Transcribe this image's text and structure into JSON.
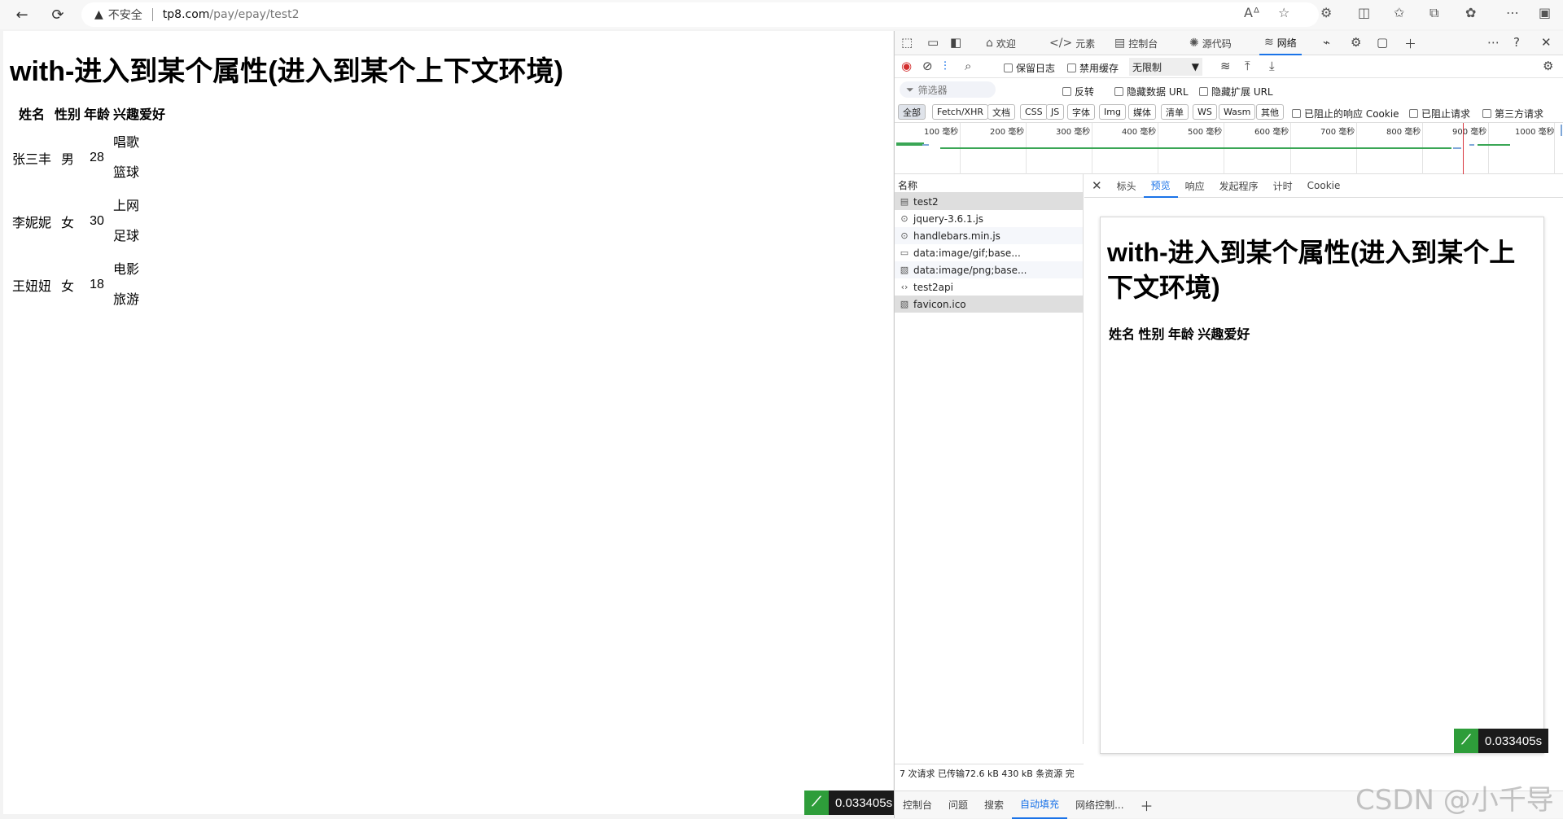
{
  "browser": {
    "security_label": "不安全",
    "url_host": "tp8.com",
    "url_path": "/pay/epay/test2"
  },
  "page": {
    "heading": "with-进入到某个属性(进入到某个上下文环境)",
    "table": {
      "headers": [
        "姓名",
        "性别",
        "年龄",
        "兴趣爱好"
      ],
      "rows": [
        {
          "name": "张三丰",
          "sex": "男",
          "age": "28",
          "hobbies": [
            "唱歌",
            "篮球"
          ]
        },
        {
          "name": "李妮妮",
          "sex": "女",
          "age": "30",
          "hobbies": [
            "上网",
            "足球"
          ]
        },
        {
          "name": "王妞妞",
          "sex": "女",
          "age": "18",
          "hobbies": [
            "电影",
            "旅游"
          ]
        }
      ]
    },
    "timer": "0.033405s"
  },
  "devtools": {
    "tabs": [
      "欢迎",
      "元素",
      "控制台",
      "源代码",
      "网络"
    ],
    "toolbar": {
      "preserve_log": "保留日志",
      "disable_cache": "禁用缓存",
      "throttle": "无限制"
    },
    "filter": {
      "placeholder": "筛选器",
      "invert": "反转",
      "hide_data_urls": "隐藏数据 URL",
      "hide_ext_urls": "隐藏扩展 URL"
    },
    "types": [
      "全部",
      "Fetch/XHR",
      "文档",
      "CSS",
      "JS",
      "字体",
      "Img",
      "媒体",
      "清单",
      "WS",
      "Wasm",
      "其他"
    ],
    "type_checks": [
      "已阻止的响应 Cookie",
      "已阻止请求",
      "第三方请求"
    ],
    "overview_ticks": [
      "100 毫秒",
      "200 毫秒",
      "300 毫秒",
      "400 毫秒",
      "500 毫秒",
      "600 毫秒",
      "700 毫秒",
      "800 毫秒",
      "900 毫秒",
      "1000 毫秒"
    ],
    "list_header": "名称",
    "requests": [
      {
        "name": "test2",
        "icon": "document-icon"
      },
      {
        "name": "jquery-3.6.1.js",
        "icon": "script-icon"
      },
      {
        "name": "handlebars.min.js",
        "icon": "script-icon"
      },
      {
        "name": "data:image/gif;base...",
        "icon": "image-icon"
      },
      {
        "name": "data:image/png;base...",
        "icon": "image-icon"
      },
      {
        "name": "test2api",
        "icon": "fetch-icon"
      },
      {
        "name": "favicon.ico",
        "icon": "image-icon"
      }
    ],
    "detail_tabs": [
      "标头",
      "预览",
      "响应",
      "发起程序",
      "计时",
      "Cookie"
    ],
    "preview": {
      "heading": "with-进入到某个属性(进入到某个上下文环境)",
      "columns": "姓名 性别 年龄 兴趣爱好",
      "timer": "0.033405s"
    },
    "status": "7 次请求  已传输72.6 kB  430 kB 条资源  完",
    "drawer_tabs": [
      "控制台",
      "问题",
      "搜索",
      "自动填充",
      "网络控制..."
    ]
  },
  "watermark": "CSDN @小千导"
}
